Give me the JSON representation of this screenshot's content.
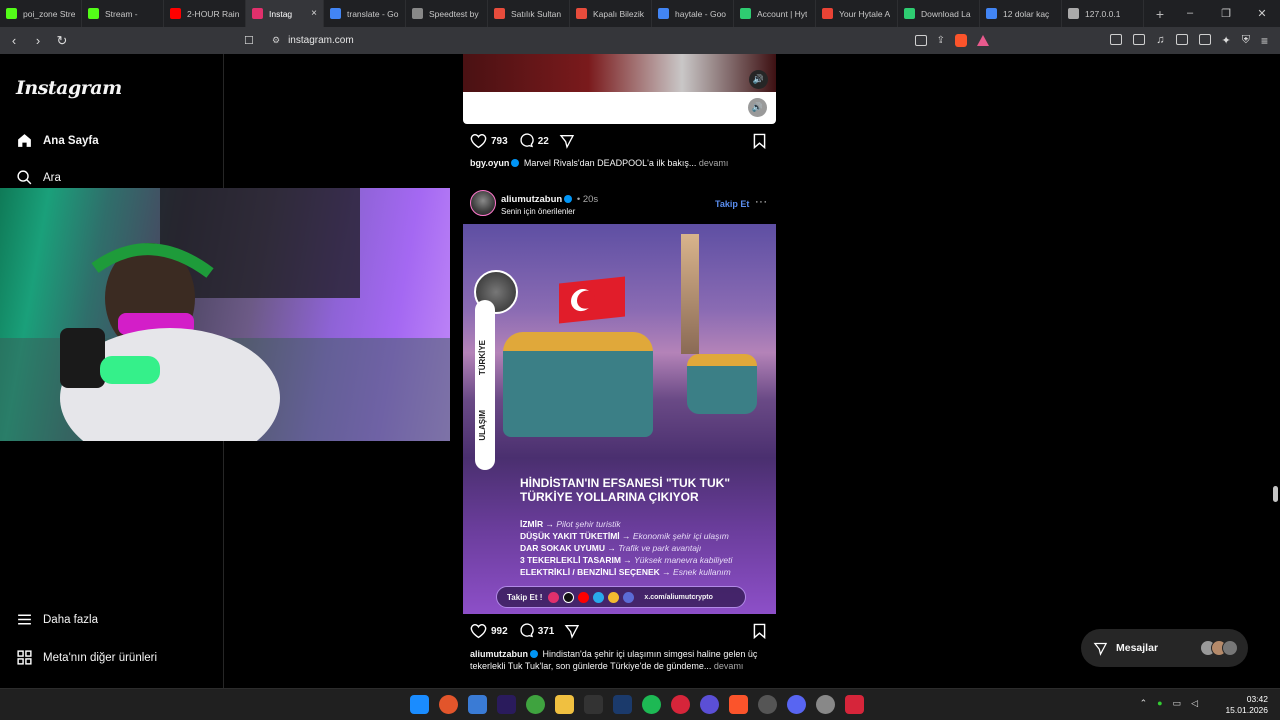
{
  "browser": {
    "tabs": [
      {
        "label": "poi_zone Stre",
        "color": "#53fc18"
      },
      {
        "label": "Stream - ",
        "color": "#53fc18"
      },
      {
        "label": "2-HOUR Rain",
        "color": "#ff0000"
      },
      {
        "label": "Instag",
        "color": "#e1306c",
        "active": true
      },
      {
        "label": "translate - Go",
        "color": "#4285f4"
      },
      {
        "label": "Speedtest by",
        "color": "#888888"
      },
      {
        "label": "Satılık Sultan",
        "color": "#e74c3c"
      },
      {
        "label": "Kapalı Bilezik",
        "color": "#e74c3c"
      },
      {
        "label": "haytale - Goo",
        "color": "#4285f4"
      },
      {
        "label": "Account | Hyt",
        "color": "#2ecc71"
      },
      {
        "label": "Your Hytale A",
        "color": "#ea4335"
      },
      {
        "label": "Download La",
        "color": "#2ecc71"
      },
      {
        "label": "12 dolar kaç",
        "color": "#4285f4"
      },
      {
        "label": "127.0.0.1",
        "color": "#aaaaaa"
      }
    ],
    "new_tab": "+",
    "close_tab": "×",
    "url": "instagram.com"
  },
  "sidebar": {
    "logo": "Instagram",
    "items": [
      {
        "label": "Ana Sayfa",
        "icon": "home-icon"
      },
      {
        "label": "Ara",
        "icon": "search-icon"
      }
    ],
    "bottom": [
      {
        "label": "Daha fazla",
        "icon": "menu-icon"
      },
      {
        "label": "Meta'nın diğer ürünleri",
        "icon": "grid-icon"
      }
    ]
  },
  "post1": {
    "likes": "793",
    "comments": "22",
    "user": "bgy.oyun",
    "caption": "Marvel Rivals'dan DEADPOOL'a ilk bakış...",
    "more": "devamı"
  },
  "post2": {
    "user": "aliumutzabun",
    "time": "• 20s",
    "subtitle": "Senin için önerilenler",
    "follow": "Takip Et",
    "more_options": "···",
    "image": {
      "headline_1": "HİNDİSTAN'IN EFSANESİ \"TUK TUK\"",
      "headline_2": "TÜRKİYE YOLLARINA ÇIKIYOR",
      "ribbon_top": "TÜRKİYE",
      "ribbon_bottom": "ULAŞIM",
      "bullets": [
        {
          "key": "İZMİR",
          "val": "Pilot şehir turistik"
        },
        {
          "key": "DÜŞÜK YAKIT TÜKETİMİ",
          "val": "Ekonomik şehir içi ulaşım"
        },
        {
          "key": "DAR SOKAK UYUMU",
          "val": "Trafik ve park avantajı"
        },
        {
          "key": "3 TEKERLEKLİ TASARIM",
          "val": "Yüksek manevra kabiliyeti"
        },
        {
          "key": "ELEKTRİKLİ / BENZİNLİ SEÇENEK",
          "val": "Esnek kullanım"
        }
      ],
      "cta": "Takip Et !",
      "cta_url": "x.com/aliumutcrypto"
    },
    "likes": "992",
    "comments": "371",
    "caption_user": "aliumutzabun",
    "caption": "Hindistan'da şehir içi ulaşımın simgesi haline gelen üç tekerlekli Tuk Tuk'lar, son günlerde Türkiye'de de gündeme...",
    "more": "devamı"
  },
  "messages": {
    "label": "Mesajlar"
  },
  "taskbar": {
    "time": "03:42",
    "date": "15.01.2026"
  }
}
